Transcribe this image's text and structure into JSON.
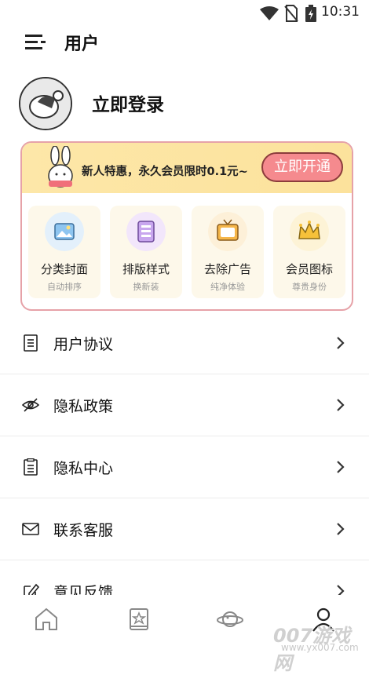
{
  "status_bar": {
    "time": "10:31"
  },
  "header": {
    "title": "用户"
  },
  "profile": {
    "login_text": "立即登录"
  },
  "vip": {
    "promo_text": "新人特惠，永久会员限时0.1元~",
    "open_button": "立即开通",
    "features": [
      {
        "title": "分类封面",
        "subtitle": "自动排序"
      },
      {
        "title": "排版样式",
        "subtitle": "换新装"
      },
      {
        "title": "去除广告",
        "subtitle": "纯净体验"
      },
      {
        "title": "会员图标",
        "subtitle": "尊贵身份"
      }
    ]
  },
  "menu": [
    {
      "label": "用户协议"
    },
    {
      "label": "隐私政策"
    },
    {
      "label": "隐私中心"
    },
    {
      "label": "联系客服"
    },
    {
      "label": "意见反馈"
    }
  ],
  "watermark": {
    "brand": "007游戏网",
    "url": "www.yx007.com"
  }
}
